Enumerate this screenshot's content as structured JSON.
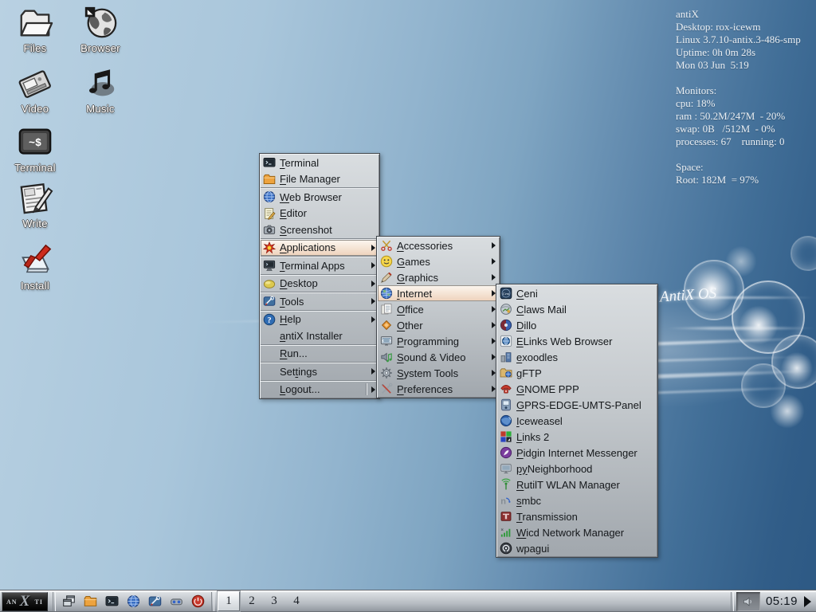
{
  "wallpaper": {
    "watermark": "AntiX OS"
  },
  "desktop_icons": [
    {
      "label": "Files",
      "icon": "files-icon"
    },
    {
      "label": "Browser",
      "icon": "browser-icon"
    },
    {
      "label": "Video",
      "icon": "video-icon"
    },
    {
      "label": "Music",
      "icon": "music-icon"
    },
    {
      "label": "Terminal",
      "icon": "terminal-desktop-icon"
    },
    {
      "label": "Write",
      "icon": "write-icon"
    },
    {
      "label": "Install",
      "icon": "install-icon"
    }
  ],
  "system_monitor": {
    "lines": [
      "antiX",
      "Desktop: rox-icewm",
      "Linux 3.7.10-antix.3-486-smp",
      "Uptime: 0h 0m 28s",
      "Mon 03 Jun  5:19",
      "",
      "Monitors:",
      "cpu: 18%",
      "ram : 50.2M/247M  - 20%",
      "swap: 0B   /512M  - 0%",
      "processes: 67    running: 0",
      "",
      "Space:",
      "Root: 182M  = 97%"
    ]
  },
  "menus": {
    "main": {
      "items": [
        {
          "label": "Terminal",
          "mnemonic": 0,
          "icon": "terminal-icon"
        },
        {
          "label": "File Manager",
          "mnemonic": 0,
          "icon": "file-manager-icon",
          "sep_after": true
        },
        {
          "label": "Web Browser",
          "mnemonic": 0,
          "icon": "web-browser-icon"
        },
        {
          "label": "Editor",
          "mnemonic": 0,
          "icon": "editor-icon"
        },
        {
          "label": "Screenshot",
          "mnemonic": 0,
          "icon": "screenshot-icon",
          "sep_after": true
        },
        {
          "label": "Applications",
          "mnemonic": 0,
          "icon": "applications-icon",
          "submenu": true,
          "selected": true,
          "sep_after": true
        },
        {
          "label": "Terminal Apps",
          "mnemonic": 0,
          "icon": "terminal-apps-icon",
          "submenu": true,
          "sep_after": true
        },
        {
          "label": "Desktop",
          "mnemonic": 0,
          "icon": "desktop-category-icon",
          "submenu": true,
          "sep_after": true
        },
        {
          "label": "Tools",
          "mnemonic": 0,
          "icon": "tools-icon",
          "submenu": true,
          "sep_after": true
        },
        {
          "label": "Help",
          "mnemonic": 0,
          "icon": "help-icon",
          "submenu": true
        },
        {
          "label": "antiX Installer",
          "mnemonic": 0,
          "icon": null,
          "sep_after": true
        },
        {
          "label": "Run...",
          "mnemonic": 0,
          "icon": null,
          "sep_after": true
        },
        {
          "label": "Settings",
          "mnemonic": 3,
          "icon": null,
          "submenu": true,
          "sep_after": true
        },
        {
          "label": "Logout...",
          "mnemonic": 0,
          "icon": null,
          "submenu": true,
          "arrow_divider": true
        }
      ]
    },
    "applications": {
      "items": [
        {
          "label": "Accessories",
          "mnemonic": 0,
          "icon": "accessories-icon",
          "submenu": true
        },
        {
          "label": "Games",
          "mnemonic": 0,
          "icon": "games-icon",
          "submenu": true
        },
        {
          "label": "Graphics",
          "mnemonic": 0,
          "icon": "graphics-icon",
          "submenu": true
        },
        {
          "label": "Internet",
          "mnemonic": 0,
          "icon": "internet-icon",
          "submenu": true,
          "selected": true
        },
        {
          "label": "Office",
          "mnemonic": 0,
          "icon": "office-icon",
          "submenu": true
        },
        {
          "label": "Other",
          "mnemonic": 0,
          "icon": "other-icon",
          "submenu": true
        },
        {
          "label": "Programming",
          "mnemonic": 0,
          "icon": "programming-icon",
          "submenu": true
        },
        {
          "label": "Sound & Video",
          "mnemonic": 0,
          "icon": "sound-video-icon",
          "submenu": true
        },
        {
          "label": "System Tools",
          "mnemonic": 0,
          "icon": "system-tools-icon",
          "submenu": true
        },
        {
          "label": "Preferences",
          "mnemonic": 0,
          "icon": "preferences-icon",
          "submenu": true
        }
      ]
    },
    "internet": {
      "items": [
        {
          "label": "Ceni",
          "mnemonic": 0,
          "icon": "ceni-icon"
        },
        {
          "label": "Claws Mail",
          "mnemonic": 0,
          "icon": "claws-mail-icon"
        },
        {
          "label": "Dillo",
          "mnemonic": 0,
          "icon": "dillo-icon"
        },
        {
          "label": "ELinks Web Browser",
          "mnemonic": 0,
          "icon": "elinks-icon"
        },
        {
          "label": "exoodles",
          "mnemonic": 0,
          "icon": "exoodles-icon"
        },
        {
          "label": "gFTP",
          "mnemonic": 0,
          "icon": "gftp-icon"
        },
        {
          "label": "GNOME PPP",
          "mnemonic": 0,
          "icon": "gnome-ppp-icon"
        },
        {
          "label": "GPRS-EDGE-UMTS-Panel",
          "mnemonic": 0,
          "icon": "gprs-panel-icon"
        },
        {
          "label": "Iceweasel",
          "mnemonic": 0,
          "icon": "iceweasel-icon"
        },
        {
          "label": "Links 2",
          "mnemonic": 0,
          "icon": "links2-icon"
        },
        {
          "label": "Pidgin Internet Messenger",
          "mnemonic": 0,
          "icon": "pidgin-icon"
        },
        {
          "label": "pyNeighborhood",
          "mnemonic": 0,
          "mnemonic_len": 2,
          "icon": "pyneighborhood-icon"
        },
        {
          "label": "RutilT WLAN Manager",
          "mnemonic": 0,
          "icon": "rutilt-icon"
        },
        {
          "label": "smbc",
          "mnemonic": 0,
          "icon": "smbc-icon"
        },
        {
          "label": "Transmission",
          "mnemonic": 0,
          "icon": "transmission-icon"
        },
        {
          "label": "Wicd Network Manager",
          "mnemonic": 0,
          "icon": "wicd-icon"
        },
        {
          "label": "wpagui",
          "mnemonic": 3,
          "icon": "wpagui-icon"
        }
      ]
    }
  },
  "taskbar": {
    "start_button": {
      "left": "AN",
      "center": "X",
      "right": "TI"
    },
    "quick_launch": [
      {
        "icon": "window-list-icon"
      },
      {
        "icon": "file-manager-icon"
      },
      {
        "icon": "terminal-icon"
      },
      {
        "icon": "web-browser-icon"
      },
      {
        "icon": "tools-icon"
      },
      {
        "icon": "devices-icon"
      },
      {
        "icon": "logout-icon"
      }
    ],
    "workspaces": [
      {
        "label": "1",
        "active": true
      },
      {
        "label": "2",
        "active": false
      },
      {
        "label": "3",
        "active": false
      },
      {
        "label": "4",
        "active": false
      }
    ],
    "volume_icon": "speaker-icon",
    "clock": "05:19",
    "expand_icon": "right-arrow-icon"
  }
}
